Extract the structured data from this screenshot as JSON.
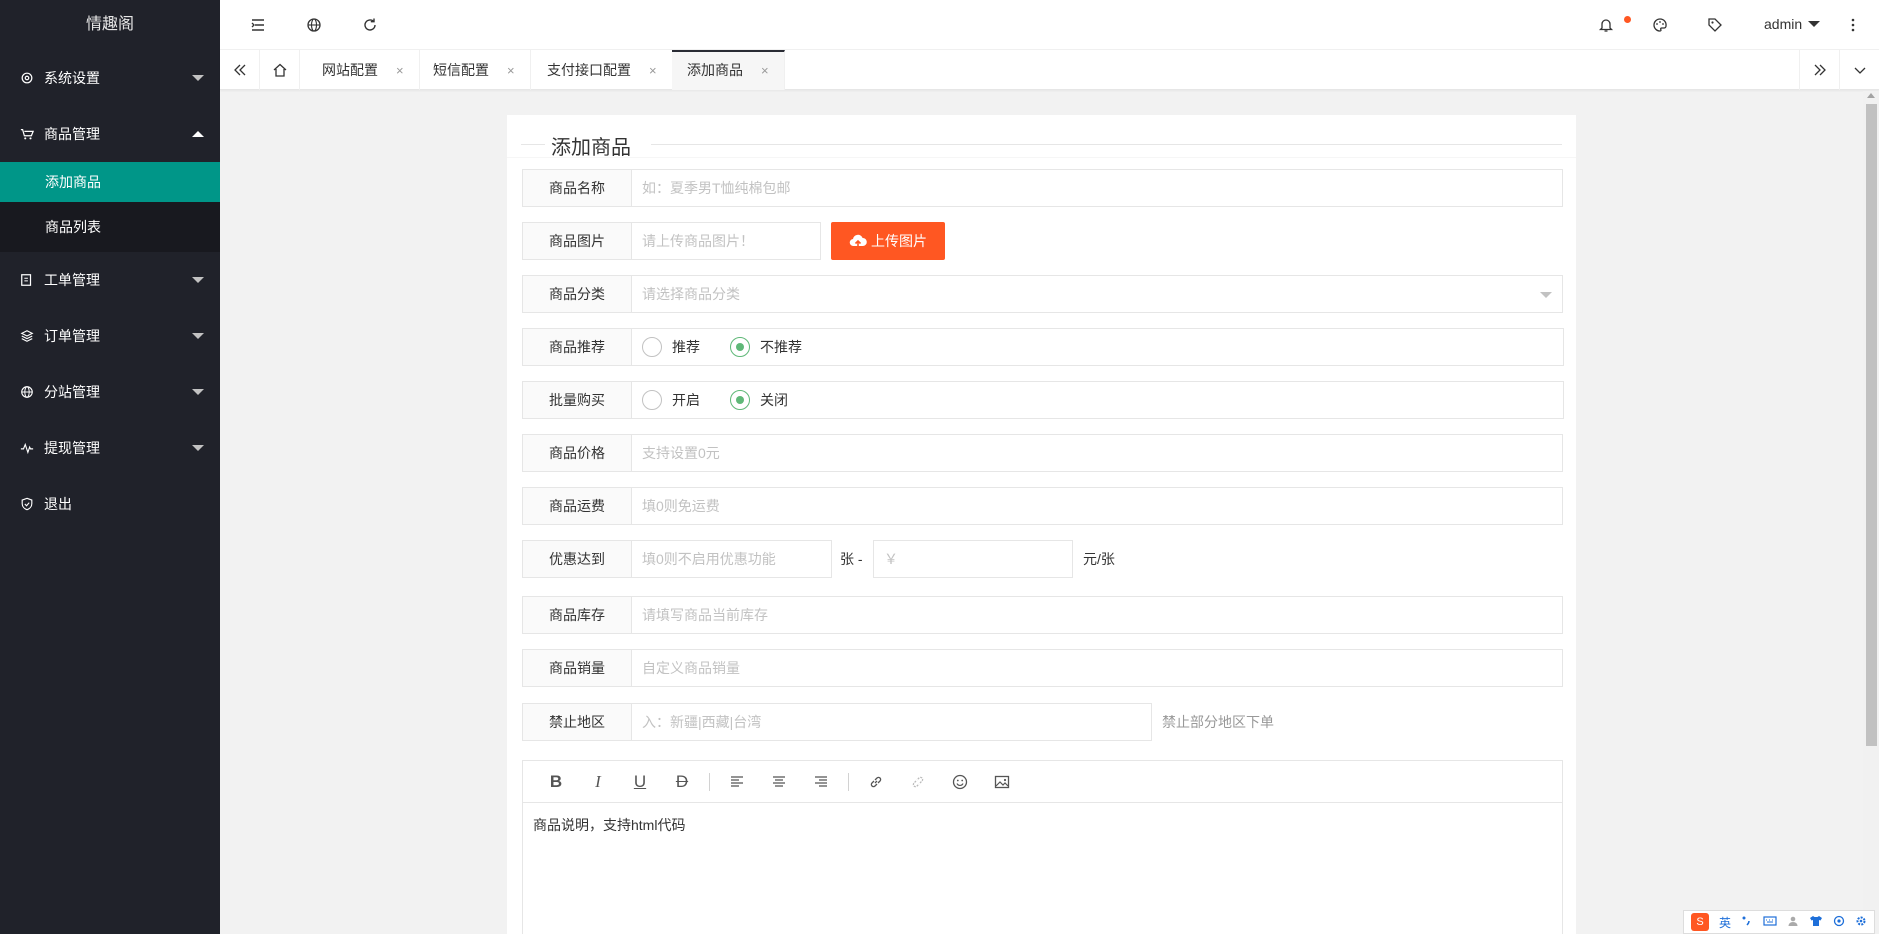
{
  "sidebar": {
    "logo": "情趣阁",
    "items": [
      {
        "label": "系统设置"
      },
      {
        "label": "商品管理"
      },
      {
        "label": "工单管理"
      },
      {
        "label": "订单管理"
      },
      {
        "label": "分站管理"
      },
      {
        "label": "提现管理"
      },
      {
        "label": "退出"
      }
    ],
    "sub_items": [
      {
        "label": "添加商品"
      },
      {
        "label": "商品列表"
      }
    ]
  },
  "header": {
    "user": "admin"
  },
  "tabs": [
    {
      "label": "网站配置"
    },
    {
      "label": "短信配置"
    },
    {
      "label": "支付接口配置"
    },
    {
      "label": "添加商品"
    }
  ],
  "tab_close": "×",
  "form": {
    "title": "添加商品",
    "name": {
      "label": "商品名称",
      "placeholder": "如：夏季男T恤纯棉包邮"
    },
    "image": {
      "label": "商品图片",
      "placeholder": "请上传商品图片！",
      "button": "上传图片"
    },
    "category": {
      "label": "商品分类",
      "placeholder": "请选择商品分类"
    },
    "recommend": {
      "label": "商品推荐",
      "options": [
        "推荐",
        "不推荐"
      ],
      "selected": "不推荐"
    },
    "bulk": {
      "label": "批量购买",
      "options": [
        "开启",
        "关闭"
      ],
      "selected": "关闭"
    },
    "price": {
      "label": "商品价格",
      "placeholder": "支持设置0元"
    },
    "shipping": {
      "label": "商品运费",
      "placeholder": "填0则免运费"
    },
    "discount": {
      "label": "优惠达到",
      "placeholder": "填0则不启用优惠功能",
      "unit1": "张 -",
      "price_placeholder": "￥",
      "unit2": "元/张"
    },
    "stock": {
      "label": "商品库存",
      "placeholder": "请填写商品当前库存"
    },
    "sales": {
      "label": "商品销量",
      "placeholder": "自定义商品销量"
    },
    "region": {
      "label": "禁止地区",
      "placeholder": "入：新疆|西藏|台湾",
      "hint": "禁止部分地区下单"
    },
    "editor": {
      "toolbar": [
        "B",
        "I",
        "U",
        "D"
      ],
      "content": "商品说明，支持html代码"
    }
  },
  "ime": {
    "logo": "S",
    "lang": "英"
  },
  "colors": {
    "sidebar": "#20222a",
    "active": "#009688",
    "upload": "#ff5722",
    "radio": "#5fb878"
  }
}
